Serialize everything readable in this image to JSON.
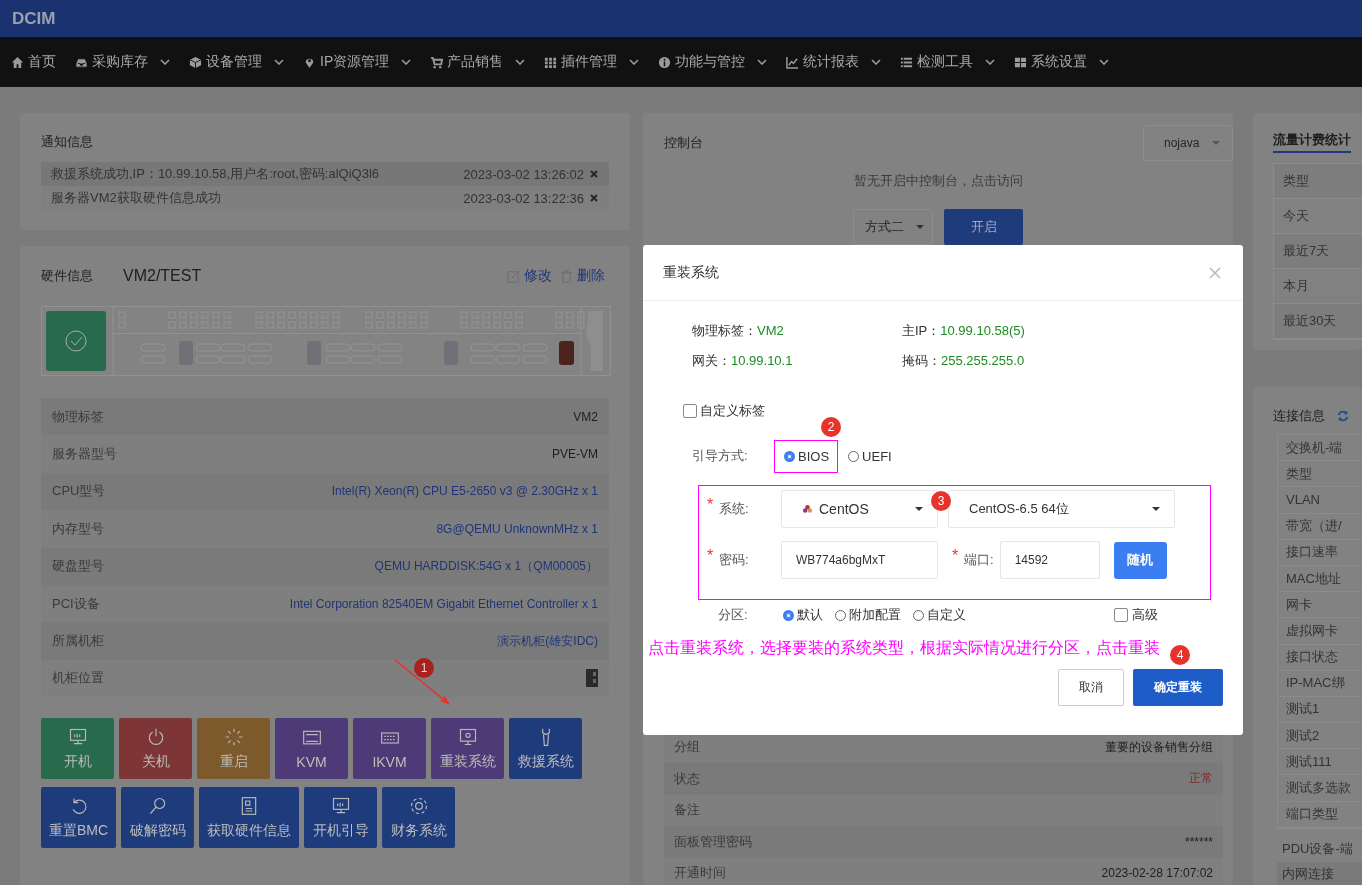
{
  "header": {
    "logo": "DCIM"
  },
  "nav": [
    {
      "label": "首页",
      "menu": false
    },
    {
      "label": "采购库存",
      "menu": true
    },
    {
      "label": "设备管理",
      "menu": true
    },
    {
      "label": "IP资源管理",
      "menu": true
    },
    {
      "label": "产品销售",
      "menu": true
    },
    {
      "label": "插件管理",
      "menu": true
    },
    {
      "label": "功能与管控",
      "menu": true
    },
    {
      "label": "统计报表",
      "menu": true
    },
    {
      "label": "检测工具",
      "menu": true
    },
    {
      "label": "系统设置",
      "menu": true
    }
  ],
  "notifications": {
    "title": "通知信息",
    "items": [
      {
        "text": "救援系统成功,IP：10.99.10.58,用户名:root,密码:alQiQ3l6",
        "time": "2023-03-02 13:26:02"
      },
      {
        "text": "服务器VM2获取硬件信息成功",
        "time": "2023-03-02 13:22:36"
      }
    ]
  },
  "hardware": {
    "title": "硬件信息",
    "name": "VM2/TEST",
    "edit": "修改",
    "delete": "删除",
    "rows": [
      {
        "label": "物理标签",
        "value": "VM2",
        "kind": "text"
      },
      {
        "label": "服务器型号",
        "value": "PVE-VM",
        "kind": "text"
      },
      {
        "label": "CPU型号",
        "value": "Intel(R) Xeon(R) CPU E5-2650 v3 @ 2.30GHz x 1",
        "kind": "link"
      },
      {
        "label": "内存型号",
        "value": "8G@QEMU UnknownMHz x 1",
        "kind": "link"
      },
      {
        "label": "硬盘型号",
        "value": "QEMU HARDDISK:54G x 1（QM00005）",
        "kind": "link"
      },
      {
        "label": "PCI设备",
        "value": "Intel Corporation 82540EM Gigabit Ethernet Controller x 1",
        "kind": "link"
      },
      {
        "label": "所属机柜",
        "value": "演示机柜(雄安IDC)",
        "kind": "link"
      },
      {
        "label": "机柜位置",
        "kind": "rack"
      }
    ],
    "actions": [
      [
        {
          "label": "开机",
          "color": "#276a4c"
        },
        {
          "label": "关机",
          "color": "#7e3535"
        },
        {
          "label": "重启",
          "color": "#7c5a2b"
        },
        {
          "label": "KVM",
          "color": "#4d3a76"
        },
        {
          "label": "IKVM",
          "color": "#4d3a76"
        },
        {
          "label": "重装系统",
          "color": "#4d3a76"
        },
        {
          "label": "救援系统",
          "color": "#1e3b7c"
        }
      ],
      [
        {
          "label": "重置BMC",
          "color": "#1e3b7c"
        },
        {
          "label": "破解密码",
          "color": "#1e3b7c"
        },
        {
          "label": "获取硬件信息",
          "color": "#1e3b7c"
        },
        {
          "label": "开机引导",
          "color": "#1e3b7c"
        },
        {
          "label": "财务系统",
          "color": "#1e3b7c"
        }
      ]
    ],
    "step_badge": "1"
  },
  "console": {
    "title": "控制台",
    "client": "nojava",
    "message": "暂无开启中控制台，点击访问",
    "method": "方式二",
    "open": "开启"
  },
  "details": [
    {
      "label": "分组",
      "value": "董要的设备销售分组"
    },
    {
      "label": "状态",
      "value": "正常",
      "color": "#7a2e2e"
    },
    {
      "label": "备注"
    },
    {
      "label": "面板管理密码",
      "value": "******"
    },
    {
      "label": "开通时间",
      "value": "2023-02-28 17:07:02"
    }
  ],
  "traffic": {
    "title": "流量计费统计",
    "rows": [
      "类型",
      "今天",
      "最近7天",
      "本月",
      "最近30天"
    ]
  },
  "connection": {
    "title": "连接信息",
    "rows": [
      "交换机-端",
      "类型",
      "VLAN",
      "带宽（进/",
      "接口速率",
      "MAC地址",
      "网卡",
      "虚拟网卡",
      "接口状态",
      "IP-MAC绑",
      "测试1",
      "测试2",
      "测试111",
      "测试多选款",
      "端口类型"
    ],
    "extra_rows": [
      "PDU设备-端",
      "内网连接"
    ]
  },
  "modal": {
    "title": "重装系统",
    "info": [
      {
        "label": "物理标签：",
        "value": "VM2"
      },
      {
        "label": "主IP：",
        "value": "10.99.10.58(5)"
      },
      {
        "label": "网关：",
        "value": "10.99.10.1"
      },
      {
        "label": "掩码：",
        "value": "255.255.255.0"
      }
    ],
    "custom_label": {
      "label": "自定义标签",
      "checked": false
    },
    "boot": {
      "label": "引导方式:",
      "options": [
        {
          "label": "BIOS",
          "selected": true
        },
        {
          "label": "UEFI",
          "selected": false
        }
      ],
      "badge": "2"
    },
    "system": {
      "required": "*",
      "label": "系统:",
      "os": "CentOS",
      "version": "CentOS-6.5 64位",
      "badge": "3"
    },
    "password": {
      "required": "*",
      "label": "密码:",
      "value": "WB774a6bgMxT"
    },
    "port": {
      "required": "*",
      "label": "端口:",
      "value": "14592"
    },
    "random": "随机",
    "partition": {
      "label": "分区:",
      "options": [
        {
          "label": "默认",
          "selected": true
        },
        {
          "label": "附加配置",
          "selected": false
        },
        {
          "label": "自定义",
          "selected": false
        }
      ]
    },
    "advanced": {
      "label": "高级",
      "checked": false
    },
    "note": "点击重装系统，选择要装的系统类型，根据实际情况进行分区，点击重装",
    "badge": "4",
    "cancel": "取消",
    "confirm": "确定重装"
  }
}
